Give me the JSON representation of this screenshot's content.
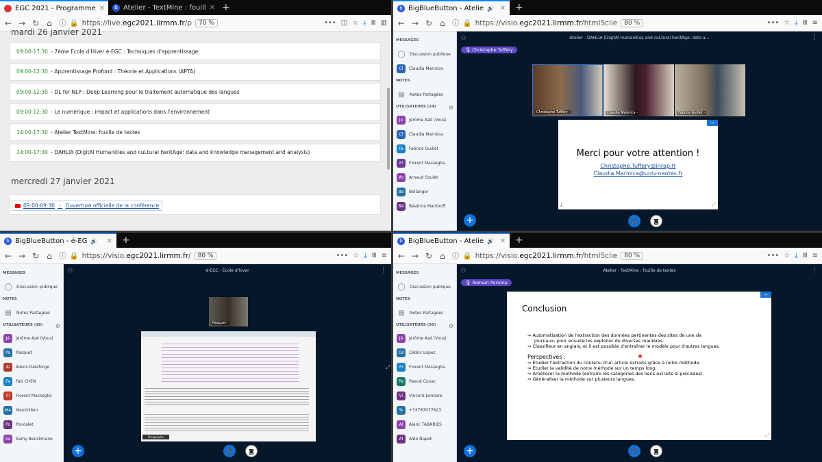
{
  "p1": {
    "tabs": [
      {
        "title": "EGC 2021 - Programme",
        "active": true
      },
      {
        "title": "Atelier - TextMine : fouill",
        "active": false
      }
    ],
    "url_prefix": "https://live.",
    "url_host": "egc2021.lirmm.fr",
    "url_rest": "/p",
    "zoom": "70 %",
    "day1_title": "mardi 26 janvier 2021",
    "events": [
      {
        "time": "09:00-17:30",
        "title": "7ème Ecole d'Hiver é-EGC : Techniques d'apprentissage"
      },
      {
        "time": "09:00-12:30",
        "title": "Apprentissage Profond : Théorie et Applications (APTA)"
      },
      {
        "time": "09:00-12:30",
        "title": "DL for NLP : Deep Learning pour le traitement automatique des langues"
      },
      {
        "time": "09:00-12:30",
        "title": "Le numérique : impact et applications dans l'environnement"
      },
      {
        "time": "14:00-17:30",
        "title": "Atelier TextMine: fouille de textes"
      },
      {
        "time": "14:00-17:30",
        "title": "DAHLIA (DigitAl Humanities and cuLtural heritAge: data and knowledge management and analysis)"
      }
    ],
    "day2_title": "mercredi 27 janvier 2021",
    "day2_event": {
      "time": "09:00-09:30",
      "title": "Ouverture officielle de la conférence"
    }
  },
  "p2": {
    "tab_title": "BigBlueButton - Atelie",
    "url_prefix": "https://visio.",
    "url_host": "egc2021.lirmm.fr",
    "url_rest": "/html5clie",
    "zoom": "80 %",
    "session_title": "Atelier - DAHLIA (DigitAl Humanities and cuLtural heritAge: data a...",
    "talker": "Christophe Tufféry",
    "sidebar": {
      "messages": "MESSAGES",
      "public_chat": "Discussion publique",
      "private_chat": "Claudia Marinica",
      "notes": "NOTES",
      "shared_notes": "Notes Partagées",
      "users_header": "UTILISATEURS (24)",
      "users": [
        {
          "i": "Jé",
          "name": "Jérôme Azé (Vous)",
          "c": "#8e44ad"
        },
        {
          "i": "Cl",
          "name": "Claudia Marinica",
          "c": "#2c67b8"
        },
        {
          "i": "Fa",
          "name": "Fabrice Guillet",
          "c": "#1a82c4"
        },
        {
          "i": "Fl",
          "name": "Florent Masseglia",
          "c": "#6a3d9a"
        },
        {
          "i": "Ar",
          "name": "Arnaud Soulet",
          "c": "#8e44ad"
        },
        {
          "i": "Be",
          "name": "Bellanger",
          "c": "#2471a3"
        },
        {
          "i": "Bé",
          "name": "Béatrice Markhoff",
          "c": "#6c3483"
        }
      ]
    },
    "cams": [
      "Christophe Tufféry -",
      "Claudia Marinica -",
      "Fabrice Guillet -"
    ],
    "slide": {
      "title": "Merci pour votre attention !",
      "email1": "Christophe.Tuffery@inrap.fr",
      "email2": "Claudia.Marinica@univ-nantes.fr"
    }
  },
  "p3": {
    "tab_title": "BigBlueButton - é-EG",
    "url_prefix": "https://visio.",
    "url_host": "egc2021.lirmm.fr",
    "url_rest": "/",
    "zoom": "80 %",
    "session_title": "é-EGC - École d'hiver",
    "sidebar": {
      "messages": "MESSAGES",
      "public_chat": "Discussion publique",
      "notes": "NOTES",
      "shared_notes": "Notes Partagées",
      "users_header": "UTILISATEURS (38)",
      "users": [
        {
          "i": "Jé",
          "name": "Jérôme Azé (Vous)",
          "c": "#8e44ad"
        },
        {
          "i": "Pa",
          "name": "Pasquet",
          "c": "#2471a3"
        },
        {
          "i": "Al",
          "name": "Alexis Delaforge",
          "c": "#b03a2e"
        },
        {
          "i": "Fa",
          "name": "Fati CHEN",
          "c": "#1a82c4"
        },
        {
          "i": "Fl",
          "name": "Florent Masseglia",
          "c": "#c0392b"
        },
        {
          "i": "Ma",
          "name": "Maximilien",
          "c": "#2471a3"
        },
        {
          "i": "Po",
          "name": "Poncelet",
          "c": "#6c3483"
        },
        {
          "i": "Sa",
          "name": "Samy Benslimane",
          "c": "#8e44ad"
        }
      ]
    },
    "cam": "Pasquet -",
    "screen_label": "Paragraphe"
  },
  "p4": {
    "tab_title": "BigBlueButton - Atelie",
    "url_prefix": "https://visio.",
    "url_host": "egc2021.lirmm.fr",
    "url_rest": "/html5clie",
    "zoom": "80 %",
    "session_title": "Atelier - TextMine : fouille de textes",
    "talker": "Romain Perrone",
    "sidebar": {
      "messages": "MESSAGES",
      "public_chat": "Discussion publique",
      "notes": "NOTES",
      "shared_notes": "Notes Partagées",
      "users_header": "UTILISATEURS (50)",
      "users": [
        {
          "i": "Jé",
          "name": "Jérôme Azé (Vous)",
          "c": "#8e44ad"
        },
        {
          "i": "Cé",
          "name": "Cédric Lopez",
          "c": "#2471a3"
        },
        {
          "i": "Fl",
          "name": "Florent Masseglia",
          "c": "#1a82c4"
        },
        {
          "i": "Pa",
          "name": "Pascal Cuxac",
          "c": "#117a65"
        },
        {
          "i": "Vi",
          "name": "Vincent Lemaire",
          "c": "#6c3483"
        },
        {
          "i": "%",
          "name": "+33787077623",
          "c": "#2471a3"
        },
        {
          "i": "Al",
          "name": "Alaric TABARIES",
          "c": "#8e44ad"
        },
        {
          "i": "Al",
          "name": "Aldo Napoli",
          "c": "#6c3483"
        }
      ]
    },
    "slide": {
      "title": "Conclusion",
      "lines": [
        "⇒ Automatisation de l'extraction des données pertinentes des sites de une de",
        "journaux, pour ensuite les exploiter de diverses manières.",
        "⇒ Classifieur en anglais, et il est possible d'entraîner le modèle pour d'autres langues."
      ],
      "persp_title": "Perspectives :",
      "persp": [
        "⇒ Étudier l'extraction du contenu d'un article extraits grâce à notre méthode.",
        "⇒ Étudier la validité de notre méthode sur un temps long.",
        "⇒ Améliorer la méthode (extraire les catégories des liens extraits si précisées).",
        "⇒ Généraliser la méthode sur plusieurs langues."
      ]
    }
  }
}
